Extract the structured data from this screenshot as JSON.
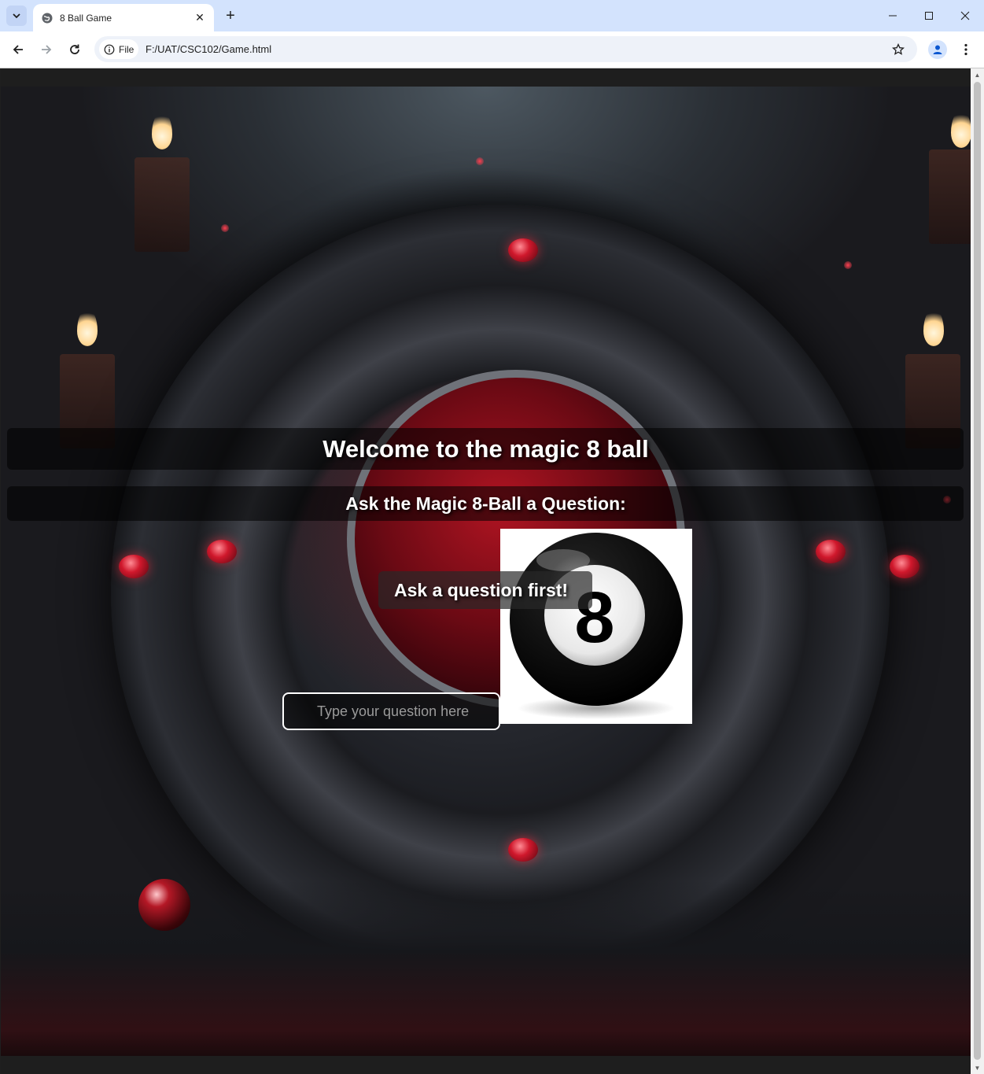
{
  "browser": {
    "tab_title": "8 Ball Game",
    "new_tab_symbol": "+",
    "tab_close_symbol": "✕",
    "site_info_label": "File",
    "url": "F:/UAT/CSC102/Game.html"
  },
  "page": {
    "heading": "Welcome to the magic 8 ball",
    "subheading": "Ask the Magic 8-Ball a Question:",
    "answer_text": "Ask a question first!",
    "question_input": {
      "placeholder": "Type your question here",
      "value": ""
    },
    "ball_number": "8"
  },
  "icons": {
    "tab_search": "chevron-down-icon",
    "favicon": "globe-icon",
    "back": "arrow-left-icon",
    "forward": "arrow-right-icon",
    "reload": "reload-icon",
    "info": "info-icon",
    "bookmark": "star-icon",
    "profile": "person-icon",
    "menu": "kebab-menu-icon",
    "minimize": "minimize-icon",
    "maximize": "maximize-icon",
    "close": "close-icon"
  },
  "colors": {
    "chrome_background": "#d3e3fd",
    "banner_background": "rgba(0,0,0,0.55)",
    "text": "#ffffff",
    "accent_red": "#d0182c"
  }
}
